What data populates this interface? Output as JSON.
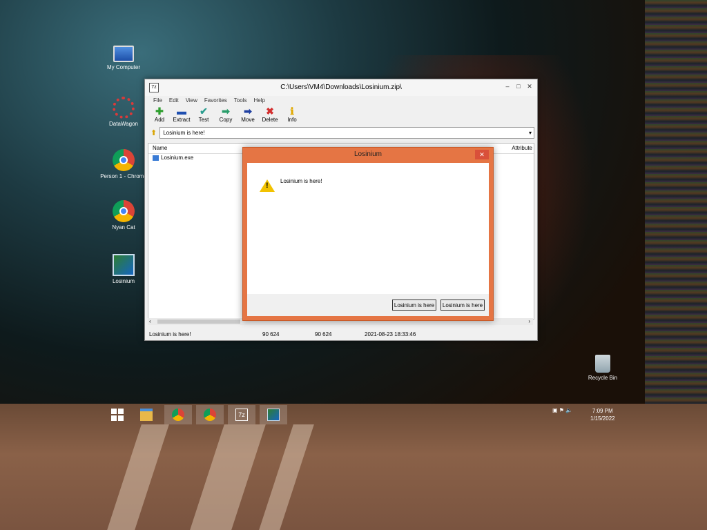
{
  "desktop": {
    "icons": [
      {
        "label": "My Computer",
        "icon": "computer-icon"
      },
      {
        "label": "DataWagon",
        "icon": "gear-icon"
      },
      {
        "label": "Person 1 - Chrome",
        "icon": "chrome-icon"
      },
      {
        "label": "Nyan Cat",
        "icon": "chrome-icon"
      },
      {
        "label": "Losinium",
        "icon": "losinium-icon"
      },
      {
        "label": "Recycle Bin",
        "icon": "recycle-bin-icon"
      }
    ]
  },
  "window": {
    "title": "C:\\Users\\VM4\\Downloads\\Losinium.zip\\",
    "menu": [
      "File",
      "Edit",
      "View",
      "Favorites",
      "Tools",
      "Help"
    ],
    "toolbar": [
      {
        "label": "Add",
        "icon": "plus-icon",
        "color": "#2e9e2e"
      },
      {
        "label": "Extract",
        "icon": "minus-icon",
        "color": "#1f4fb0"
      },
      {
        "label": "Test",
        "icon": "check-icon",
        "color": "#2a9d8f"
      },
      {
        "label": "Copy",
        "icon": "arrow-right-icon",
        "color": "#2a9d6a"
      },
      {
        "label": "Move",
        "icon": "arrow-right-icon",
        "color": "#1f3fa0"
      },
      {
        "label": "Delete",
        "icon": "x-icon",
        "color": "#d32f2f"
      },
      {
        "label": "Info",
        "icon": "info-icon",
        "color": "#e0a800"
      }
    ],
    "address": "Losinium is here!",
    "columns": {
      "name": "Name",
      "attributes": "Attribute"
    },
    "files": [
      {
        "name": "Losinium.exe"
      }
    ],
    "status": {
      "text": "Losinium is here!",
      "size": "90 624",
      "packed": "90 624",
      "modified": "2021-08-23 18:33:46"
    }
  },
  "dialog": {
    "title": "Losinium",
    "close": "✕",
    "message": "Losinium is here!",
    "button1": "Losinium is here",
    "button2": "Losinium is here"
  },
  "taskbar": {
    "clock_time": "7:09 PM",
    "clock_date": "1/15/2022"
  }
}
